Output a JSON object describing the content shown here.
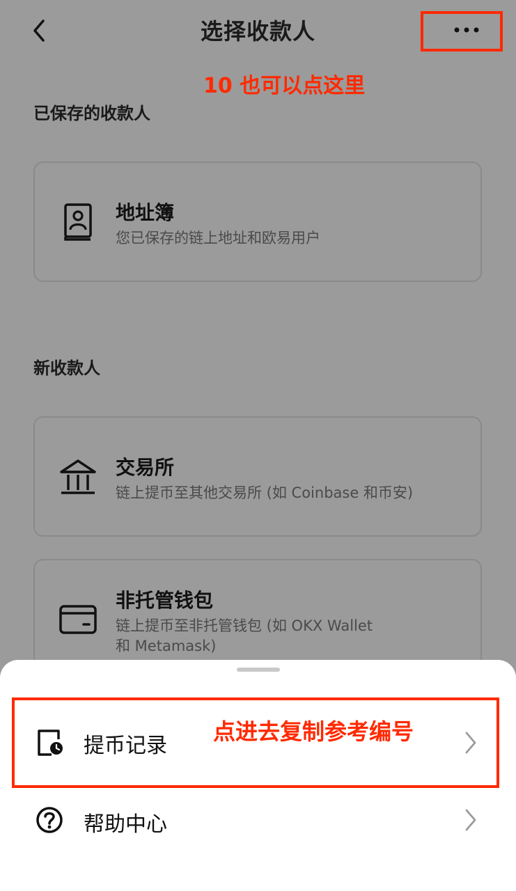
{
  "header": {
    "title": "选择收款人",
    "back_icon": "chevron-left-icon",
    "more_icon": "more-horizontal-icon"
  },
  "annotations": {
    "more_hint": "10 也可以点这里",
    "records_hint": "点进去复制参考编号",
    "highlight_color": "#ff2a00"
  },
  "saved_section": {
    "heading": "已保存的收款人",
    "items": [
      {
        "icon": "address-book-icon",
        "title": "地址簿",
        "subtitle": "您已保存的链上地址和欧易用户"
      }
    ]
  },
  "new_section": {
    "heading": "新收款人",
    "items": [
      {
        "icon": "bank-icon",
        "title": "交易所",
        "subtitle": "链上提币至其他交易所 (如 Coinbase 和币安)"
      },
      {
        "icon": "wallet-icon",
        "title": "非托管钱包",
        "subtitle_line1": "链上提币至非托管钱包 (如 OKX Wallet",
        "subtitle_line2": "和 Metamask)"
      }
    ]
  },
  "sheet": {
    "items": [
      {
        "icon": "withdrawal-history-icon",
        "label": "提币记录"
      },
      {
        "icon": "help-circle-icon",
        "label": "帮助中心"
      }
    ]
  }
}
